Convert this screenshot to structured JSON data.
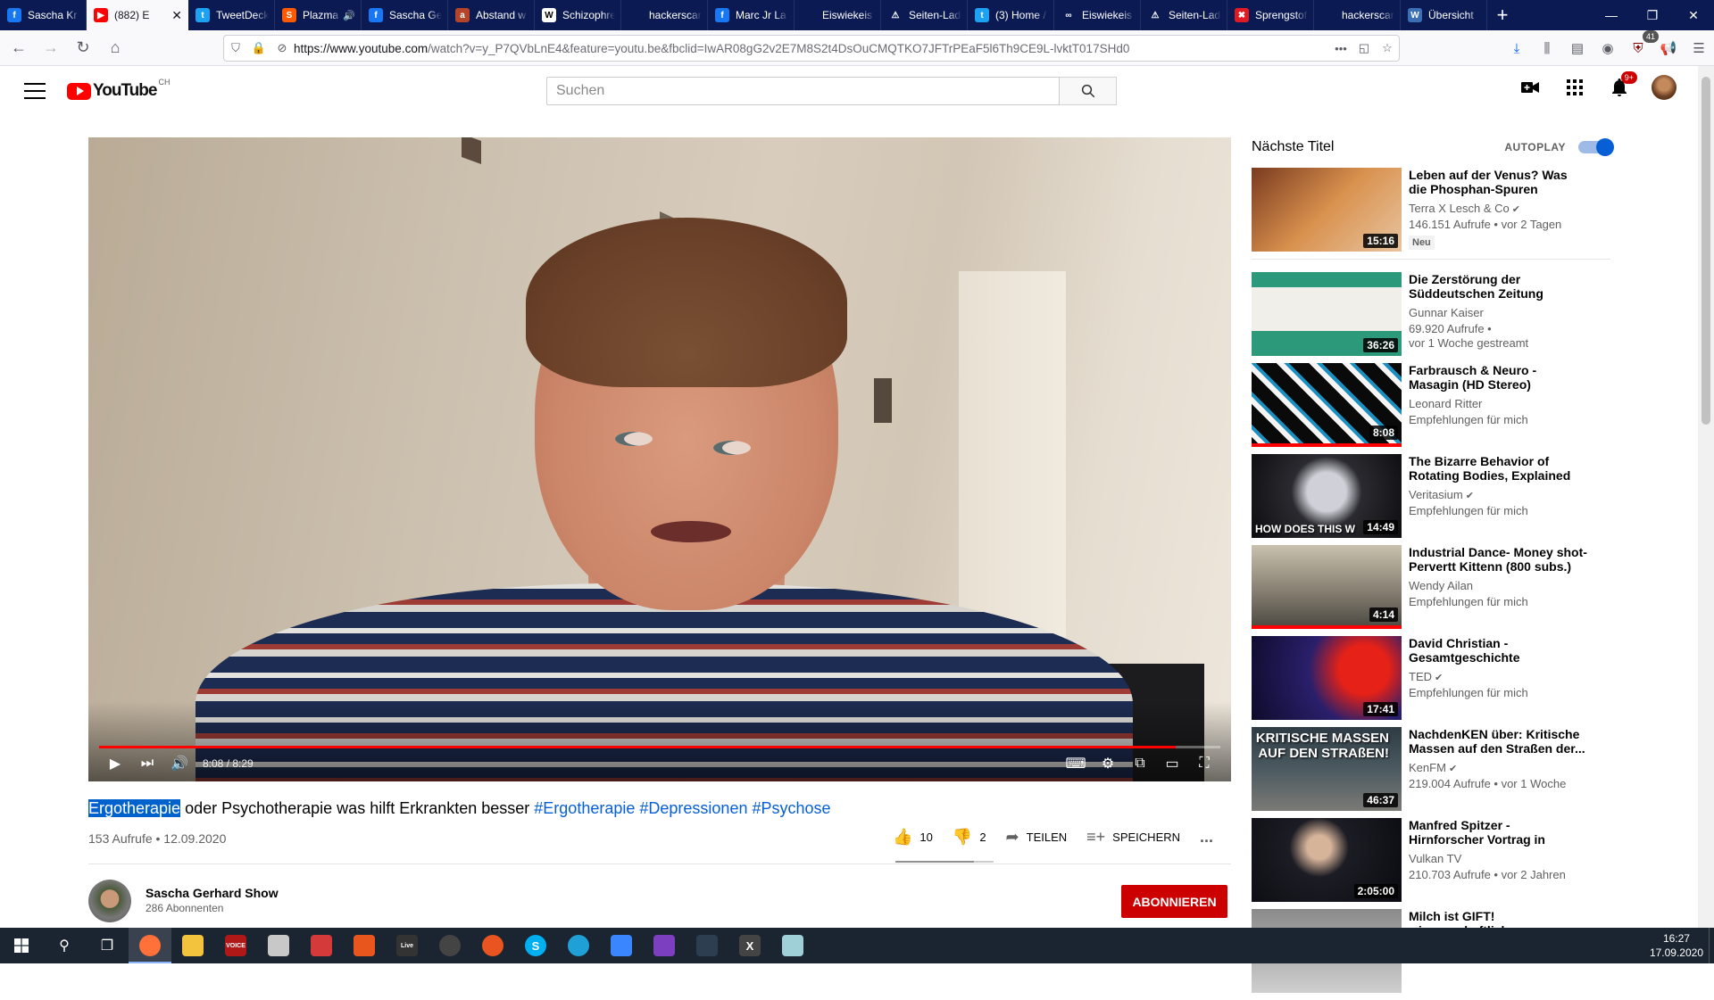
{
  "browser": {
    "tabs": [
      {
        "label": "Sascha Kr",
        "color": "#1877f2",
        "glyph": "f"
      },
      {
        "label": "(882) E",
        "color": "#ff0000",
        "glyph": "▶",
        "active": true
      },
      {
        "label": "TweetDeck",
        "color": "#1da1f2",
        "glyph": "t"
      },
      {
        "label": "Plazma",
        "color": "#ff5a00",
        "glyph": "S",
        "audio": true
      },
      {
        "label": "Sascha Ge",
        "color": "#1877f2",
        "glyph": "f"
      },
      {
        "label": "Abstand w",
        "color": "#b5452a",
        "glyph": "a"
      },
      {
        "label": "Schizophre",
        "color": "#ffffff",
        "glyph": "W"
      },
      {
        "label": "hackerscardgar",
        "color": "#0b1a53",
        "glyph": ""
      },
      {
        "label": "Marc Jr La",
        "color": "#1877f2",
        "glyph": "f"
      },
      {
        "label": "Eiswiekeis – Ze",
        "color": "#0b1a53",
        "glyph": ""
      },
      {
        "label": "Seiten-Lad",
        "color": "#0b1a53",
        "glyph": "⚠"
      },
      {
        "label": "(3) Home /",
        "color": "#1da1f2",
        "glyph": "t"
      },
      {
        "label": "Eiswiekeis",
        "color": "#0b1a53",
        "glyph": "∞"
      },
      {
        "label": "Seiten-Lad",
        "color": "#0b1a53",
        "glyph": "⚠"
      },
      {
        "label": "Sprengstof",
        "color": "#e01b24",
        "glyph": "✖"
      },
      {
        "label": "hackerscardgar",
        "color": "#0b1a53",
        "glyph": ""
      },
      {
        "label": "Übersicht",
        "color": "#3b6fb6",
        "glyph": "W"
      }
    ],
    "url_main": "https://www.youtube.com",
    "url_rest": "/watch?v=y_P7QVbLnE4&feature=youtu.be&fbclid=IwAR08gG2v2E7M8S2t4DsOuCMQTKO7JFTrPEaF5l6Th9CE9L-lvktT017SHd0",
    "ext_badge": "41"
  },
  "header": {
    "logo_text": "YouTube",
    "country": "CH",
    "search_placeholder": "Suchen",
    "notif_count": "9+"
  },
  "player": {
    "time": "8:08 / 8:29",
    "progress": 0.96
  },
  "video": {
    "title_highlight": "Ergotherapie",
    "title_rest": " oder Psychotherapie was hilft Erkrankten besser ",
    "hashtags": [
      "#Ergotherapie",
      "#Depressionen",
      "#Psychose"
    ],
    "meta": "153 Aufrufe • 12.09.2020",
    "likes": "10",
    "dislikes": "2",
    "share_label": "TEILEN",
    "save_label": "SPEICHERN",
    "more": "..."
  },
  "channel": {
    "name": "Sascha Gerhard Show",
    "subs": "286 Abonnenten",
    "subscribe_label": "ABONNIEREN"
  },
  "sidebar": {
    "heading": "Nächste Titel",
    "autoplay_label": "AUTOPLAY",
    "items": [
      {
        "title": "Leben auf der Venus? Was die Phosphan-Spuren bedeuten |...",
        "channel": "Terra X Lesch & Co",
        "verified": true,
        "meta": "146.151 Aufrufe • vor 2 Tagen",
        "badge": "Neu",
        "duration": "15:16",
        "thumb": "linear-gradient(135deg,#7a3b1f,#d9914e 50%,#e8c4a0)",
        "overlay": "",
        "watched": false
      },
      {
        "title": "Die Zerstörung der Süddeutschen Zeitung",
        "channel": "Gunnar Kaiser",
        "verified": false,
        "meta": "69.920 Aufrufe • \nvor 1 Woche gestreamt",
        "badge": "",
        "duration": "36:26",
        "thumb": "linear-gradient(180deg,#2c9a7a 0 18%,#f1efe9 18% 70%,#2c9a7a 70%)",
        "overlay": "",
        "watched": false
      },
      {
        "title": "Farbrausch & Neuro - Masagin (HD Stereo)",
        "channel": "Leonard Ritter",
        "verified": false,
        "meta": "Empfehlungen für mich",
        "badge": "",
        "duration": "8:08",
        "thumb": "repeating-linear-gradient(45deg,#0a0a0a 0 8px,#f5f5f5 8px 14px,#1b8ec2 14px 18px,#0a0a0a 18px 26px)",
        "overlay": "",
        "watched": true
      },
      {
        "title": "The Bizarre Behavior of Rotating Bodies, Explained",
        "channel": "Veritasium",
        "verified": true,
        "meta": "Empfehlungen für mich",
        "badge": "",
        "duration": "14:49",
        "thumb": "radial-gradient(circle at 50% 45%,#d0d0d8 0 22%,#2a2a30 40%,#0d0d10)",
        "overlay": "HOW DOES THIS W",
        "watched": false
      },
      {
        "title": "Industrial Dance- Money shot- Pervertt Kittenn (800 subs.)",
        "channel": "Wendy Ailan",
        "verified": false,
        "meta": "Empfehlungen für mich",
        "badge": "",
        "duration": "4:14",
        "thumb": "linear-gradient(180deg,#c9c1ad 0%,#8c8577 50%,#4a4740 100%)",
        "overlay": "",
        "watched": true
      },
      {
        "title": "David Christian - Gesamtgeschichte",
        "channel": "TED",
        "verified": true,
        "meta": "Empfehlungen für mich",
        "badge": "",
        "duration": "17:41",
        "thumb": "radial-gradient(circle at 75% 40%,#e62117 0 20%,#2a1f6b 45%,#0d0b2a)",
        "overlay": "",
        "watched": false
      },
      {
        "title": "NachdenKEN über: Kritische Massen auf den Straßen der...",
        "channel": "KenFM",
        "verified": true,
        "meta": "219.004 Aufrufe • vor 1 Woche",
        "badge": "",
        "duration": "46:37",
        "thumb": "linear-gradient(180deg,#2e3b44 0%,#4b5a60 50%,#7a7a76 100%)",
        "overlay": "KRITISCHE MASSEN AUF DEN STRAßEN!",
        "watched": false
      },
      {
        "title": "Manfred Spitzer - Hirnforscher Vortrag in Feldbach | vulkantv.at",
        "channel": "Vulkan TV",
        "verified": false,
        "meta": "210.703 Aufrufe • vor 2 Jahren",
        "badge": "",
        "duration": "2:05:00",
        "thumb": "radial-gradient(circle at 45% 35%,#d6b49a 0 12%,#1c1c24 30%,#0a0a10)",
        "overlay": "",
        "watched": false
      },
      {
        "title": "Milch ist GIFT! wissenschaftlich",
        "channel": "",
        "verified": false,
        "meta": "",
        "badge": "",
        "duration": "",
        "thumb": "linear-gradient(180deg,#8a8a8a,#cfcfcf)",
        "overlay": "",
        "watched": false
      }
    ]
  },
  "taskbar": {
    "apps": [
      {
        "name": "search",
        "glyph": "⚲",
        "color": ""
      },
      {
        "name": "task-view",
        "glyph": "❐",
        "color": ""
      },
      {
        "name": "firefox",
        "glyph": "",
        "color": "#ff7139",
        "active": true
      },
      {
        "name": "explorer",
        "glyph": "",
        "color": "#f4c33d"
      },
      {
        "name": "voicemeeter",
        "glyph": "VOICE",
        "color": "#b01818"
      },
      {
        "name": "app-5",
        "glyph": "",
        "color": "#c8c8c8"
      },
      {
        "name": "app-6",
        "glyph": "",
        "color": "#d43a3a"
      },
      {
        "name": "app-7",
        "glyph": "",
        "color": "#e8561d"
      },
      {
        "name": "live",
        "glyph": "Live",
        "color": "#333333"
      },
      {
        "name": "obs",
        "glyph": "",
        "color": "#444444"
      },
      {
        "name": "ubuntu",
        "glyph": "",
        "color": "#e95420"
      },
      {
        "name": "skype",
        "glyph": "S",
        "color": "#00aff0"
      },
      {
        "name": "edge",
        "glyph": "",
        "color": "#1fa0d6"
      },
      {
        "name": "app-13",
        "glyph": "",
        "color": "#3a86ff"
      },
      {
        "name": "app-14",
        "glyph": "",
        "color": "#7b3fbf"
      },
      {
        "name": "app-15",
        "glyph": "",
        "color": "#2c3e50"
      },
      {
        "name": "app-16",
        "glyph": "X",
        "color": "#444444"
      },
      {
        "name": "app-17",
        "glyph": "",
        "color": "#9fd0d8"
      }
    ],
    "time": "16:27",
    "date": "17.09.2020"
  }
}
